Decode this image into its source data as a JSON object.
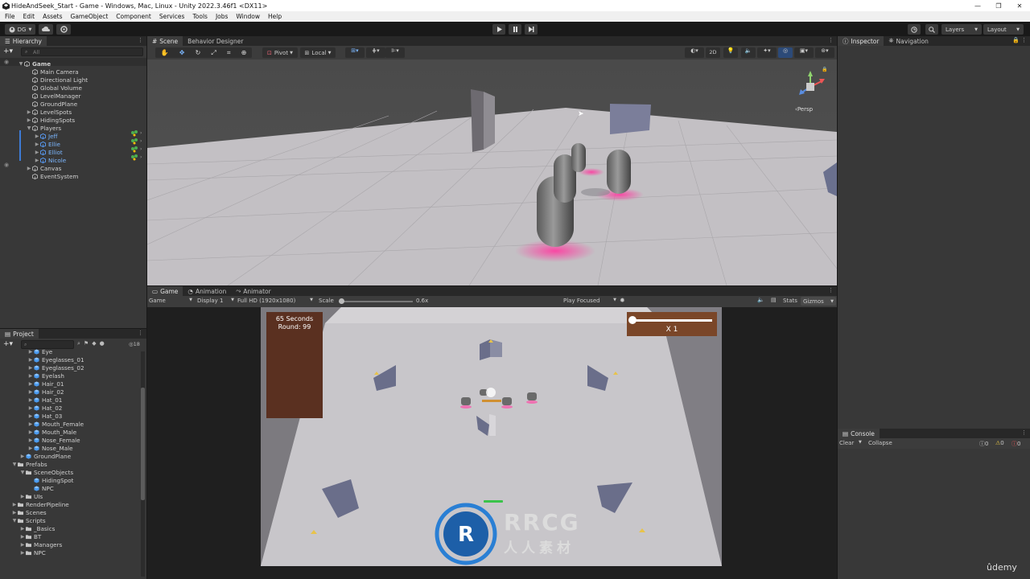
{
  "window": {
    "title": "HideAndSeek_Start - Game - Windows, Mac, Linux - Unity 2022.3.46f1 <DX11>",
    "min_icon": "—",
    "max_icon": "❐",
    "close_icon": "✕"
  },
  "menu": [
    "File",
    "Edit",
    "Assets",
    "GameObject",
    "Component",
    "Services",
    "Tools",
    "Jobs",
    "Window",
    "Help"
  ],
  "toolbar": {
    "account_label": "DG",
    "layers_label": "Layers",
    "layout_label": "Layout"
  },
  "hierarchy": {
    "tab": "Hierarchy",
    "search_placeholder": "All",
    "items": [
      {
        "label": "Game",
        "depth": 0
      },
      {
        "label": "Main Camera",
        "depth": 1
      },
      {
        "label": "Directional Light",
        "depth": 1
      },
      {
        "label": "Global Volume",
        "depth": 1
      },
      {
        "label": "LevelManager",
        "depth": 1
      },
      {
        "label": "GroundPlane",
        "depth": 1
      },
      {
        "label": "LevelSpots",
        "depth": 1
      },
      {
        "label": "HidingSpots",
        "depth": 1
      },
      {
        "label": "Players",
        "depth": 1
      },
      {
        "label": "Jeff",
        "depth": 2
      },
      {
        "label": "Ellie",
        "depth": 2
      },
      {
        "label": "Elliot",
        "depth": 2
      },
      {
        "label": "Nicole",
        "depth": 2
      },
      {
        "label": "Canvas",
        "depth": 1
      },
      {
        "label": "EventSystem",
        "depth": 1
      }
    ]
  },
  "scene": {
    "tabs": [
      "Scene",
      "Behavior Designer"
    ],
    "pivot_label": "Pivot",
    "local_label": "Local",
    "mode_2d": "2D",
    "persp_label": "Persp"
  },
  "game": {
    "tabs": [
      "Game",
      "Animation",
      "Animator"
    ],
    "mode_label": "Game",
    "display_label": "Display 1",
    "resolution_label": "Full HD (1920x1080)",
    "scale_label": "Scale",
    "scale_value": "0.6x",
    "play_focused_label": "Play Focused",
    "stats_label": "Stats",
    "gizmos_label": "Gizmos",
    "hud": {
      "seconds": "65 Seconds",
      "round": "Round: 99",
      "multiplier": "X 1"
    }
  },
  "project": {
    "tab": "Project",
    "count": "18",
    "items": [
      {
        "label": "Eye",
        "depth": 2,
        "type": "prefab"
      },
      {
        "label": "Eyeglasses_01",
        "depth": 2,
        "type": "prefab"
      },
      {
        "label": "Eyeglasses_02",
        "depth": 2,
        "type": "prefab"
      },
      {
        "label": "Eyelash",
        "depth": 2,
        "type": "prefab"
      },
      {
        "label": "Hair_01",
        "depth": 2,
        "type": "prefab"
      },
      {
        "label": "Hair_02",
        "depth": 2,
        "type": "prefab"
      },
      {
        "label": "Hat_01",
        "depth": 2,
        "type": "prefab"
      },
      {
        "label": "Hat_02",
        "depth": 2,
        "type": "prefab"
      },
      {
        "label": "Hat_03",
        "depth": 2,
        "type": "prefab"
      },
      {
        "label": "Mouth_Female",
        "depth": 2,
        "type": "prefab"
      },
      {
        "label": "Mouth_Male",
        "depth": 2,
        "type": "prefab"
      },
      {
        "label": "Nose_Female",
        "depth": 2,
        "type": "prefab"
      },
      {
        "label": "Nose_Male",
        "depth": 2,
        "type": "prefab"
      },
      {
        "label": "GroundPlane",
        "depth": 1,
        "type": "prefab"
      },
      {
        "label": "Prefabs",
        "depth": 0,
        "type": "folder"
      },
      {
        "label": "SceneObjects",
        "depth": 1,
        "type": "folder"
      },
      {
        "label": "HidingSpot",
        "depth": 2,
        "type": "prefab"
      },
      {
        "label": "NPC",
        "depth": 2,
        "type": "prefab"
      },
      {
        "label": "UIs",
        "depth": 1,
        "type": "folder"
      },
      {
        "label": "RenderPipeline",
        "depth": 0,
        "type": "folder"
      },
      {
        "label": "Scenes",
        "depth": 0,
        "type": "folder"
      },
      {
        "label": "Scripts",
        "depth": 0,
        "type": "folder"
      },
      {
        "label": "_Basics",
        "depth": 1,
        "type": "folder"
      },
      {
        "label": "BT",
        "depth": 1,
        "type": "folder"
      },
      {
        "label": "Managers",
        "depth": 1,
        "type": "folder"
      },
      {
        "label": "NPC",
        "depth": 1,
        "type": "folder"
      }
    ]
  },
  "inspector": {
    "tabs": [
      "Inspector",
      "Navigation"
    ]
  },
  "console": {
    "tab": "Console",
    "clear_label": "Clear",
    "collapse_label": "Collapse",
    "log_count": "0",
    "warn_count": "0",
    "error_count": "0"
  },
  "watermark": {
    "brand": "RRCG",
    "sub": "人人素材",
    "udemy": "ûdemy"
  },
  "colors": {
    "accent": "#3d7bd6",
    "selected_blue": "#7cb7ff",
    "hud_panel": "#5a3020",
    "hud_multiplier": "#7a4628"
  }
}
